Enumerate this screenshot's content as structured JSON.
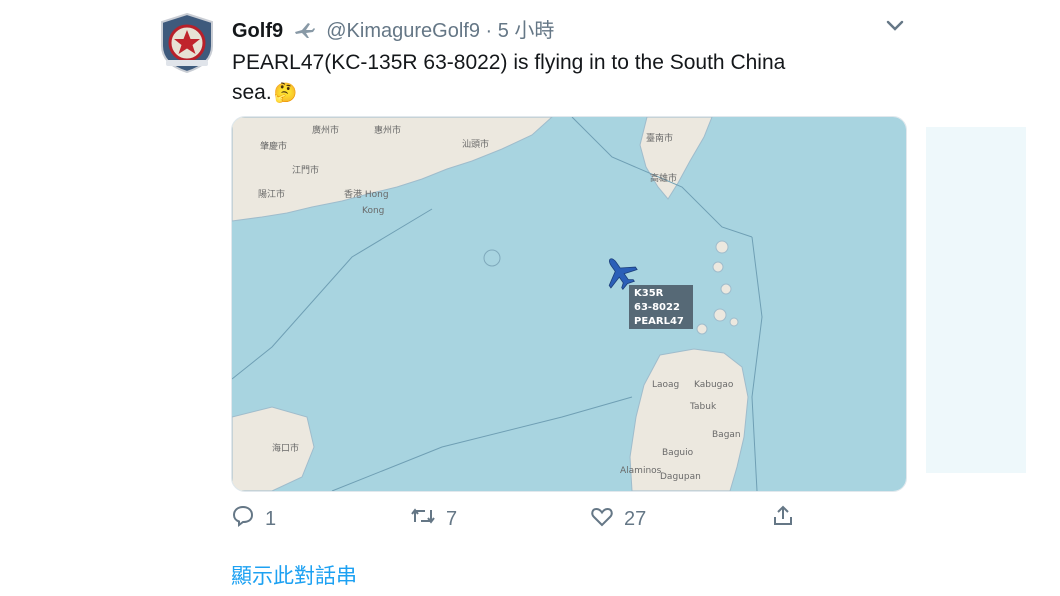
{
  "tweet": {
    "display_name": "Golf9",
    "handle": "@KimagureGolf9",
    "separator": "·",
    "time": "5 小時",
    "text_line1": "PEARL47(KC-135R 63-8022) is flying in to the South China",
    "text_line2": "sea.",
    "emoji": "🤔",
    "map": {
      "track_label": [
        "K35R",
        "63-8022",
        "PEARL47"
      ],
      "place_labels": [
        "廣州市",
        "惠州市",
        "汕頭市",
        "肇慶市",
        "江門市",
        "陽江市",
        "香港 Hong",
        "Kong",
        "臺南市",
        "高雄市",
        "Laoag",
        "Kabugao",
        "Tabuk",
        "Bagan",
        "Baguio",
        "Dagupan",
        "Alaminos",
        "海口市"
      ]
    },
    "actions": {
      "replies": "1",
      "retweets": "7",
      "likes": "27"
    },
    "thread_link": "顯示此對話串"
  },
  "colors": {
    "link": "#1da1f2",
    "muted": "#657786",
    "sea": "#a8d4e0",
    "land": "#ece8df",
    "aircraft": "#2b5fb8"
  },
  "icons": [
    "avatar-emblem",
    "plane-emoji-icon",
    "chevron-down-icon",
    "reply-icon",
    "retweet-icon",
    "like-icon",
    "share-icon",
    "aircraft-icon"
  ]
}
